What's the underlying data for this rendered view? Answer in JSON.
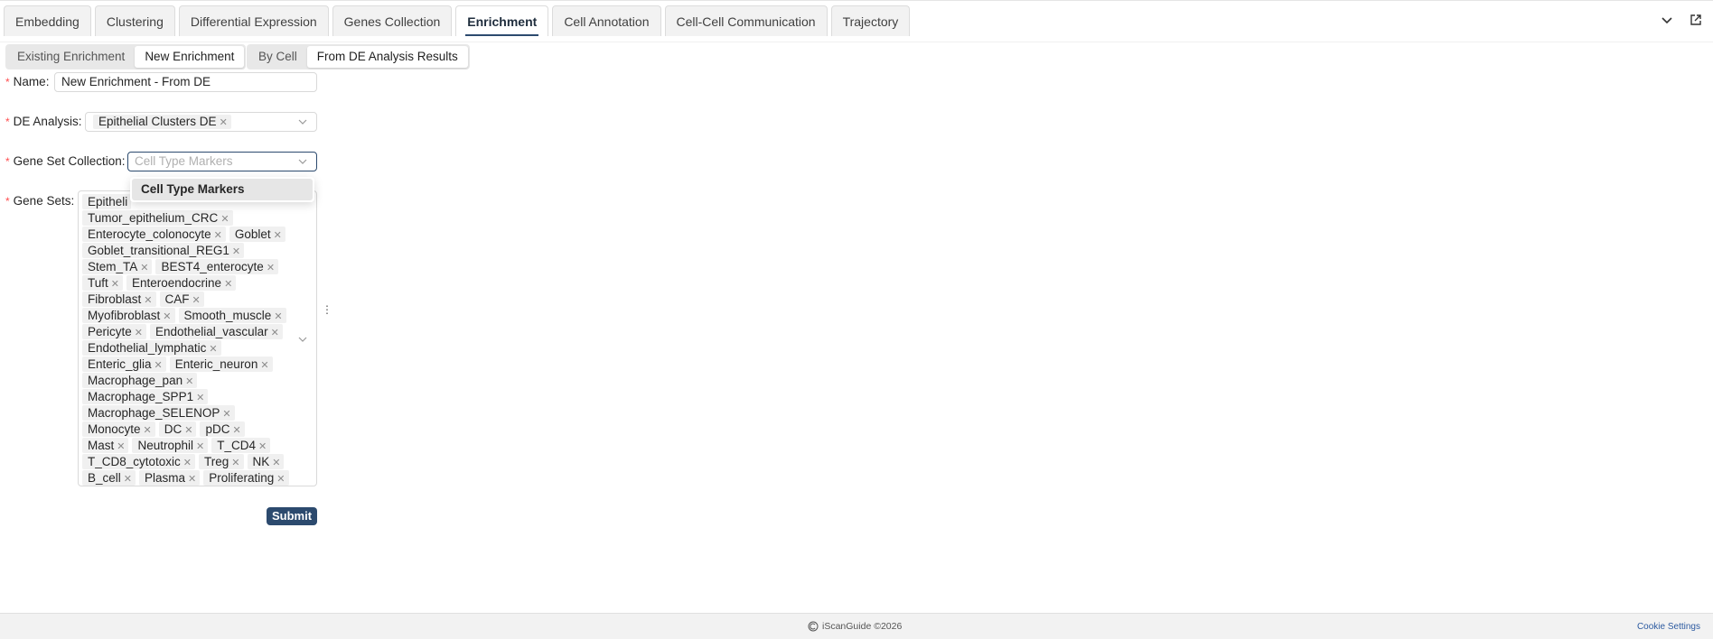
{
  "tabs": [
    "Embedding",
    "Clustering",
    "Differential Expression",
    "Genes Collection",
    "Enrichment",
    "Cell Annotation",
    "Cell-Cell Communication",
    "Trajectory"
  ],
  "active_tab": "Enrichment",
  "mode_toggle": {
    "options": [
      "Existing Enrichment",
      "New Enrichment"
    ],
    "selected": "New Enrichment"
  },
  "source_toggle": {
    "options": [
      "By Cell",
      "From DE Analysis Results"
    ],
    "selected": "From DE Analysis Results"
  },
  "form": {
    "name_label": "Name",
    "name_value": "New Enrichment - From DE",
    "de_label": "DE Analysis",
    "de_tag": "Epithelial Clusters DE",
    "collection_label": "Gene Set Collection",
    "collection_placeholder": "Cell Type Markers",
    "gene_sets_label": "Gene Sets",
    "gene_sets": [
      [
        "Epitheli"
      ],
      [
        "Tumor_epithelium_CRC"
      ],
      [
        "Enterocyte_colonocyte",
        "Goblet"
      ],
      [
        "Goblet_transitional_REG1"
      ],
      [
        "Stem_TA",
        "BEST4_enterocyte"
      ],
      [
        "Tuft",
        "Enteroendocrine"
      ],
      [
        "Fibroblast",
        "CAF"
      ],
      [
        "Myofibroblast",
        "Smooth_muscle"
      ],
      [
        "Pericyte",
        "Endothelial_vascular"
      ],
      [
        "Endothelial_lymphatic"
      ],
      [
        "Enteric_glia",
        "Enteric_neuron"
      ],
      [
        "Macrophage_pan"
      ],
      [
        "Macrophage_SPP1"
      ],
      [
        "Macrophage_SELENOP"
      ],
      [
        "Monocyte",
        "DC",
        "pDC"
      ],
      [
        "Mast",
        "Neutrophil",
        "T_CD4"
      ],
      [
        "T_CD8_cytotoxic",
        "Treg",
        "NK"
      ],
      [
        "B_cell",
        "Plasma",
        "Proliferating"
      ]
    ],
    "dropdown_option": "Cell Type Markers",
    "submit_label": "Submit"
  },
  "footer": {
    "copyright": "iScanGuide ©2026",
    "cookie": "Cookie Settings"
  }
}
